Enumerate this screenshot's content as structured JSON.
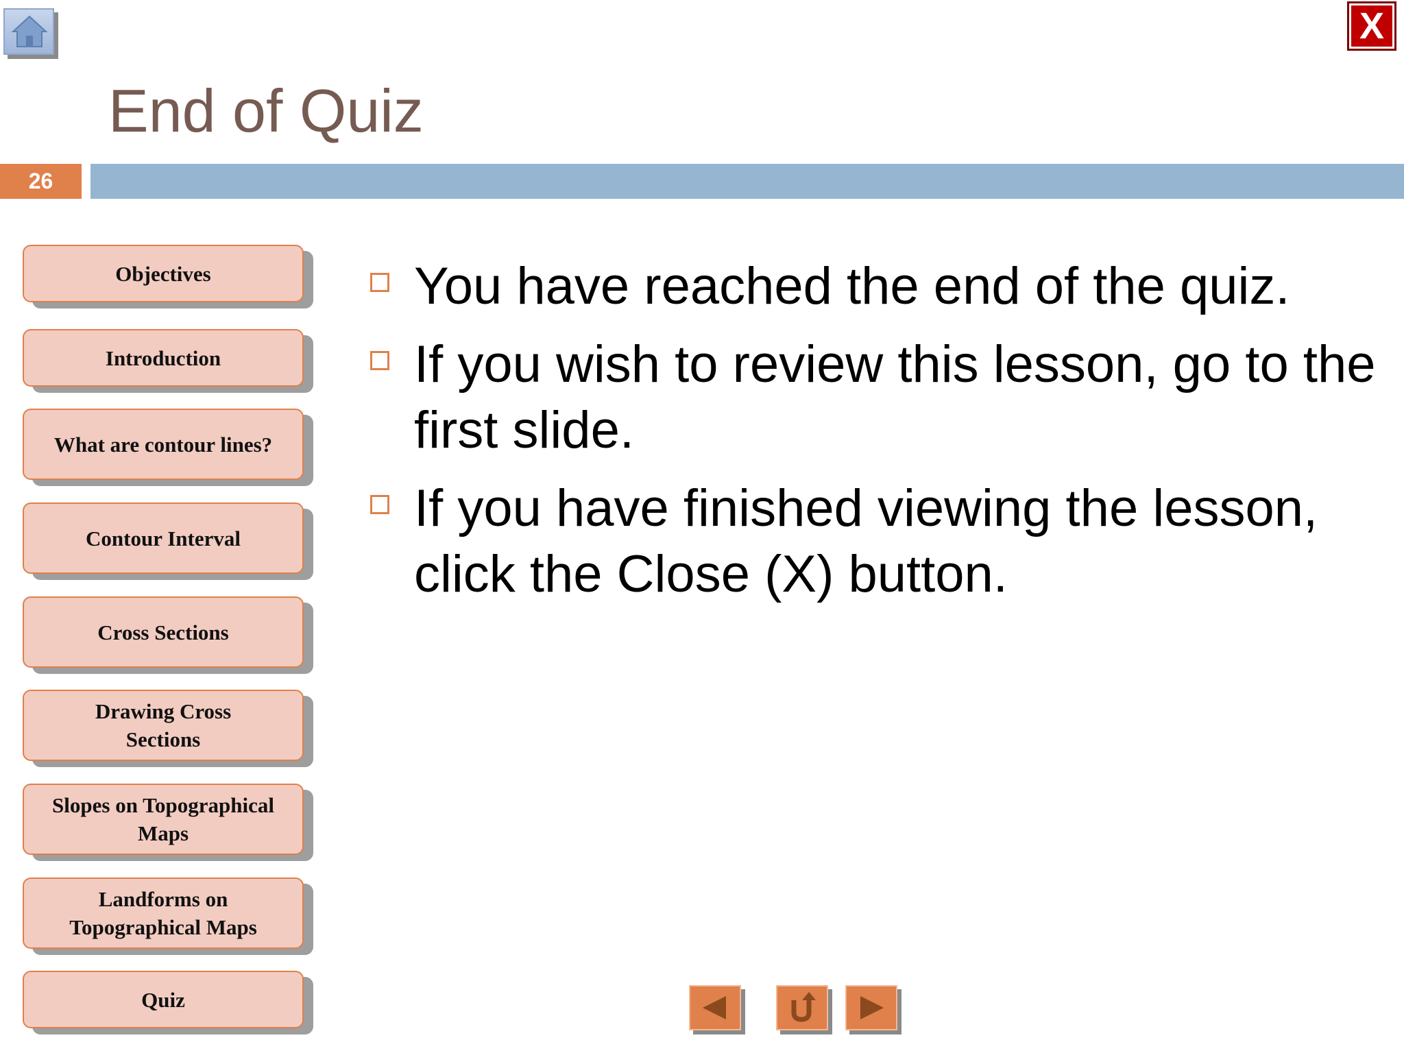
{
  "header": {
    "title": "End of Quiz",
    "slide_number": "26",
    "home_icon": "home-icon",
    "close_label": "X"
  },
  "sidebar": {
    "items": [
      {
        "label": "Objectives"
      },
      {
        "label": "Introduction"
      },
      {
        "label": "What are contour lines?"
      },
      {
        "label": "Contour Interval"
      },
      {
        "label": "Cross Sections"
      },
      {
        "label": "Drawing Cross Sections"
      },
      {
        "label": "Slopes on Topographical Maps"
      },
      {
        "label": "Landforms on Topographical Maps"
      },
      {
        "label": "Quiz"
      }
    ]
  },
  "content": {
    "bullets": [
      "You have reached the end of the quiz.",
      "If you wish to review this lesson, go to the first slide.",
      "If you have finished viewing the lesson, click the Close  (X) button."
    ]
  },
  "nav": {
    "prev_icon": "triangle-left-icon",
    "return_icon": "return-arrow-icon",
    "next_icon": "triangle-right-icon"
  },
  "colors": {
    "accent": "#e0804a",
    "title_bar": "#95b5d1",
    "title_text": "#765b52",
    "sidebar_fill": "#f2ccc1",
    "close_red": "#c00000"
  }
}
